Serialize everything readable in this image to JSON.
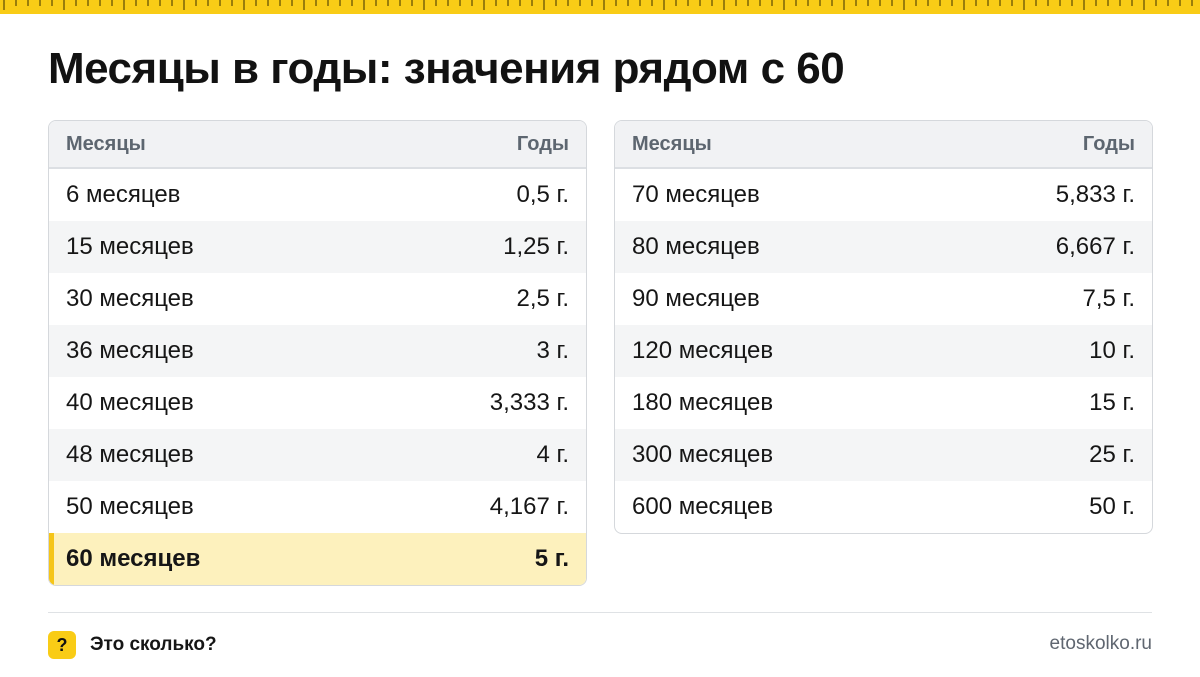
{
  "title": "Месяцы в годы: значения рядом с 60",
  "tables": [
    {
      "header": {
        "col1": "Месяцы",
        "col2": "Годы"
      },
      "rows": [
        {
          "months": "6 месяцев",
          "years": "0,5 г."
        },
        {
          "months": "15 месяцев",
          "years": "1,25 г."
        },
        {
          "months": "30 месяцев",
          "years": "2,5 г."
        },
        {
          "months": "36 месяцев",
          "years": "3 г."
        },
        {
          "months": "40 месяцев",
          "years": "3,333 г."
        },
        {
          "months": "48 месяцев",
          "years": "4 г."
        },
        {
          "months": "50 месяцев",
          "years": "4,167 г."
        },
        {
          "months": "60 месяцев",
          "years": "5 г.",
          "highlighted": true
        }
      ]
    },
    {
      "header": {
        "col1": "Месяцы",
        "col2": "Годы"
      },
      "rows": [
        {
          "months": "70 месяцев",
          "years": "5,833 г."
        },
        {
          "months": "80 месяцев",
          "years": "6,667 г."
        },
        {
          "months": "90 месяцев",
          "years": "7,5 г."
        },
        {
          "months": "120 месяцев",
          "years": "10 г."
        },
        {
          "months": "180 месяцев",
          "years": "15 г."
        },
        {
          "months": "300 месяцев",
          "years": "25 г."
        },
        {
          "months": "600 месяцев",
          "years": "50 г."
        }
      ]
    }
  ],
  "footer": {
    "badge": "?",
    "brand": "Это сколько?",
    "site": "etoskolko.ru"
  },
  "colors": {
    "accent": "#f9cc16",
    "highlight_row": "#fdf1bd",
    "header_bg": "#f1f2f4"
  },
  "icons": {
    "badge": "question-mark-icon"
  }
}
